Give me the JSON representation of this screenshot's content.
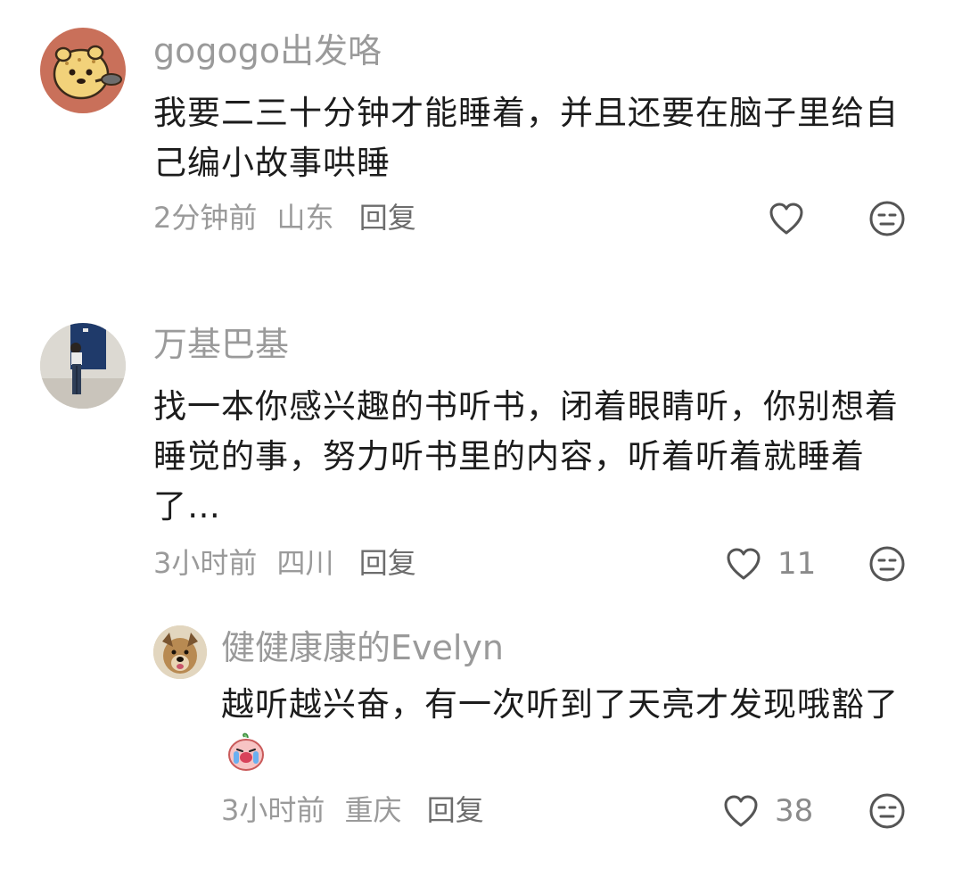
{
  "comments": [
    {
      "username": "gogogo出发咯",
      "text": "我要二三十分钟才能睡着，并且还要在脑子里给自己编小故事哄睡",
      "time": "2分钟前",
      "location": "山东",
      "reply_label": "回复",
      "likes": ""
    },
    {
      "username": "万基巴基",
      "text": "找一本你感兴趣的书听书，闭着眼睛听，你别想着睡觉的事，努力听书里的内容，听着听着就睡着了…",
      "time": "3小时前",
      "location": "四川",
      "reply_label": "回复",
      "likes": "11",
      "replies": [
        {
          "username": "健健康康的Evelyn",
          "text": "越听越兴奋，有一次听到了天亮才发现哦豁了",
          "time": "3小时前",
          "location": "重庆",
          "reply_label": "回复",
          "likes": "38"
        }
      ]
    }
  ],
  "icons": {
    "like": "heart-outline-icon",
    "dislike": "unamused-face-icon",
    "sticker": "crying-peach-sticker"
  },
  "colors": {
    "muted": "#9a9a9a",
    "text": "#1c1c1c",
    "icon": "#555555",
    "avatar1_bg": "#c9705a"
  }
}
